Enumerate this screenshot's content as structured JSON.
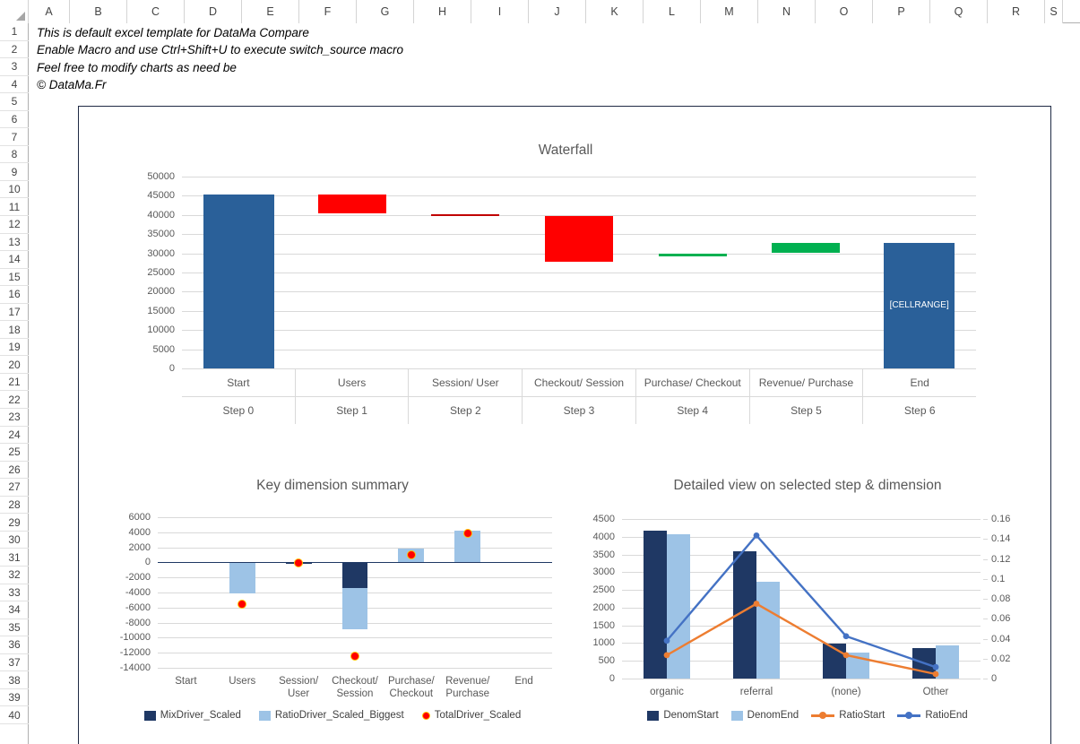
{
  "spreadsheet": {
    "columns": [
      "A",
      "B",
      "C",
      "D",
      "E",
      "F",
      "G",
      "H",
      "I",
      "J",
      "K",
      "L",
      "M",
      "N",
      "O",
      "P",
      "Q",
      "R",
      "S"
    ],
    "rows": [
      1,
      2,
      3,
      4,
      5,
      6,
      7,
      8,
      9,
      10,
      11,
      12,
      13,
      14,
      15,
      16,
      17,
      18,
      19,
      20,
      21,
      22,
      23,
      24,
      25,
      26,
      27,
      28,
      29,
      30,
      31,
      32,
      33,
      34,
      35,
      36,
      37,
      38,
      39,
      40
    ],
    "notes": [
      "This is default excel template for DataMa Compare",
      "Enable Macro and use Ctrl+Shift+U to execute switch_source macro",
      "Feel free to modify charts as need be",
      "© DataMa.Fr"
    ]
  },
  "colors": {
    "steel_blue": "#2a6099",
    "red": "#ff0000",
    "dark_red": "#c00000",
    "green": "#00b050",
    "navy": "#1f3864",
    "light_blue": "#9dc3e6",
    "orange": "#ed7d31",
    "blue_line": "#4472c4",
    "dot_red": "#ff0000",
    "border": "#1f2a44"
  },
  "chart_data": [
    {
      "type": "bar",
      "name": "waterfall",
      "title": "Waterfall",
      "xlabel": "",
      "ylabel": "",
      "ylim": [
        0,
        50000
      ],
      "yticks": [
        0,
        5000,
        10000,
        15000,
        20000,
        25000,
        30000,
        35000,
        40000,
        45000,
        50000
      ],
      "grid": true,
      "categories": [
        "Start",
        "Users",
        "Session/ User",
        "Checkout/ Session",
        "Purchase/ Checkout",
        "Revenue/ Purchase",
        "End"
      ],
      "steps": [
        "Step 0",
        "Step 1",
        "Step 2",
        "Step 3",
        "Step 4",
        "Step 5",
        "Step 6"
      ],
      "bars": [
        {
          "category": "Start",
          "base": 0,
          "top": 45400,
          "kind": "total",
          "color": "#2a6099",
          "label": ""
        },
        {
          "category": "Users",
          "base": 40500,
          "top": 45400,
          "kind": "decrease",
          "color": "#ff0000",
          "label": ""
        },
        {
          "category": "Session/ User",
          "base": 40100,
          "top": 40300,
          "kind": "decrease",
          "color": "#c00000",
          "label": ""
        },
        {
          "category": "Checkout/ Session",
          "base": 27800,
          "top": 39700,
          "kind": "decrease",
          "color": "#ff0000",
          "label": ""
        },
        {
          "category": "Purchase/ Checkout",
          "base": 29100,
          "top": 29800,
          "kind": "increase",
          "color": "#00b050",
          "label": ""
        },
        {
          "category": "Revenue/ Purchase",
          "base": 30200,
          "top": 32700,
          "kind": "increase",
          "color": "#00b050",
          "label": ""
        },
        {
          "category": "End",
          "base": 0,
          "top": 32700,
          "kind": "total",
          "color": "#2a6099",
          "label": "[CELLRANGE]"
        }
      ]
    },
    {
      "type": "bar",
      "name": "key-dimension-summary",
      "title": "Key dimension summary",
      "xlabel": "",
      "ylabel": "",
      "ylim": [
        -14000,
        6000
      ],
      "yticks": [
        6000,
        4000,
        2000,
        0,
        -2000,
        -4000,
        -6000,
        -8000,
        -10000,
        -12000,
        -14000
      ],
      "ytick_labels": [
        "6000",
        "4000",
        "2000",
        "0",
        "-2000",
        "-4000",
        "-6000",
        "-8000",
        "-10000",
        "-12000",
        "-14000"
      ],
      "grid": true,
      "categories": [
        "Start",
        "Users",
        "Session/\nUser",
        "Checkout/\nSession",
        "Purchase/\nCheckout",
        "Revenue/\nPurchase",
        "End"
      ],
      "legend_position": "bottom",
      "series": [
        {
          "name": "MixDriver_Scaled",
          "marker": "square",
          "color": "#1f3864",
          "values": [
            0,
            0,
            -150,
            -3400,
            0,
            0,
            0
          ]
        },
        {
          "name": "RatioDriver_Scaled_Biggest",
          "marker": "square",
          "color": "#9dc3e6",
          "values": [
            0,
            -4100,
            0,
            -5450,
            1800,
            4250,
            0
          ]
        },
        {
          "name": "TotalDriver_Scaled",
          "marker": "dot",
          "color": "#ff0000",
          "values": [
            null,
            -5500,
            -100,
            -12400,
            1000,
            3850,
            null
          ]
        }
      ]
    },
    {
      "type": "bar",
      "name": "detailed-view",
      "title": "Detailed view on selected step & dimension",
      "xlabel": "",
      "ylabel": "",
      "ylim": [
        0,
        4500
      ],
      "yticks": [
        0,
        500,
        1000,
        1500,
        2000,
        2500,
        3000,
        3500,
        4000,
        4500
      ],
      "y2lim": [
        0,
        0.16
      ],
      "y2ticks": [
        0,
        0.02,
        0.04,
        0.06,
        0.08,
        0.1,
        0.12,
        0.14,
        0.16
      ],
      "y2tick_labels": [
        "0",
        "0.02",
        "0.04",
        "0.06",
        "0.08",
        "0.1",
        "0.12",
        "0.14",
        "0.16"
      ],
      "grid": true,
      "categories": [
        "organic",
        "referral",
        "(none)",
        "Other"
      ],
      "legend_position": "bottom",
      "series": [
        {
          "name": "DenomStart",
          "type": "bar",
          "axis": "left",
          "color": "#1f3864",
          "values": [
            4180,
            3580,
            990,
            850
          ]
        },
        {
          "name": "DenomEnd",
          "type": "bar",
          "axis": "left",
          "color": "#9dc3e6",
          "values": [
            4070,
            2730,
            740,
            930
          ]
        },
        {
          "name": "RatioStart",
          "type": "line",
          "axis": "right",
          "color": "#ed7d31",
          "values": [
            0.0235,
            0.075,
            0.0235,
            0.0045
          ]
        },
        {
          "name": "RatioEnd",
          "type": "line",
          "axis": "right",
          "color": "#4472c4",
          "values": [
            0.038,
            0.1435,
            0.0425,
            0.0115
          ]
        }
      ]
    }
  ]
}
